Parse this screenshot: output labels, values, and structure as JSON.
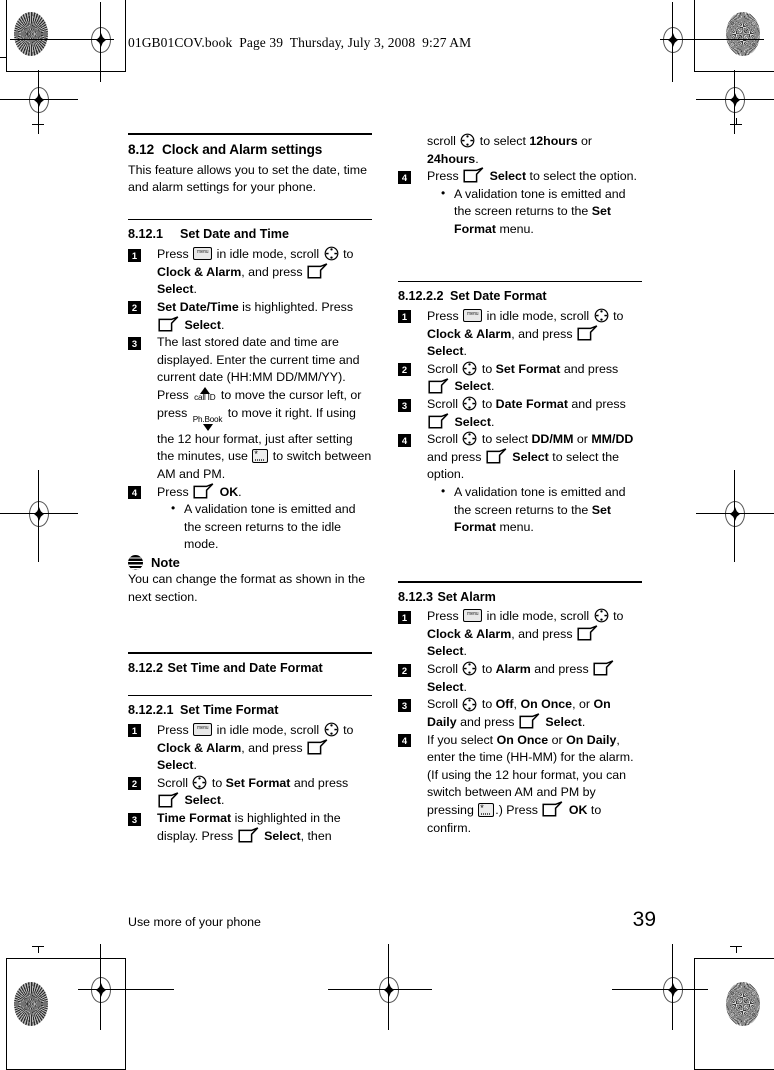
{
  "header": {
    "proof_line": "01GB01COV.book  Page 39  Thursday, July 3, 2008  9:27 AM"
  },
  "footer": {
    "running_title": "Use more of your phone",
    "page_number": "39"
  },
  "icons": {
    "menu_key": "menu",
    "star_key": "*",
    "call_id_label": "call ID",
    "phonebook_label": "Ph.Book",
    "soft_key": "soft-key",
    "scroll_key": "scroll-key",
    "note": "note-icon"
  },
  "left_column": {
    "section": {
      "number": "8.12",
      "title": "Clock and Alarm settings",
      "intro": "This feature allows you to set the date, time and alarm settings for your phone."
    },
    "sub1": {
      "number": "8.12.1",
      "title": "Set Date and Time",
      "steps": [
        {
          "n": "1",
          "parts": [
            {
              "t": "text",
              "v": "Press "
            },
            {
              "t": "icon",
              "v": "menu"
            },
            {
              "t": "text",
              "v": " in idle mode, scroll "
            },
            {
              "t": "icon",
              "v": "scroll"
            },
            {
              "t": "text",
              "v": " to "
            },
            {
              "t": "bold",
              "v": "Clock & Alarm"
            },
            {
              "t": "text",
              "v": ", and press "
            },
            {
              "t": "icon",
              "v": "soft"
            },
            {
              "t": "bold",
              "v": " Select"
            },
            {
              "t": "text",
              "v": "."
            }
          ]
        },
        {
          "n": "2",
          "parts": [
            {
              "t": "bold",
              "v": "Set Date/Time"
            },
            {
              "t": "text",
              "v": " is highlighted. Press "
            },
            {
              "t": "icon",
              "v": "soft"
            },
            {
              "t": "bold",
              "v": " Select"
            },
            {
              "t": "text",
              "v": "."
            }
          ]
        },
        {
          "n": "3",
          "parts": [
            {
              "t": "text",
              "v": "The last stored date and time are displayed. Enter the current time and current date (HH:MM DD/MM/YY). Press "
            },
            {
              "t": "icon",
              "v": "callid"
            },
            {
              "t": "text",
              "v": " to move the cursor left, or press "
            },
            {
              "t": "icon",
              "v": "phbook"
            },
            {
              "t": "text",
              "v": " to move it right. If using the 12 hour format, just after setting the minutes, use "
            },
            {
              "t": "icon",
              "v": "star"
            },
            {
              "t": "text",
              "v": " to switch between AM and PM."
            }
          ]
        },
        {
          "n": "4",
          "parts": [
            {
              "t": "text",
              "v": "Press "
            },
            {
              "t": "icon",
              "v": "soft"
            },
            {
              "t": "bold",
              "v": " OK"
            },
            {
              "t": "text",
              "v": "."
            }
          ],
          "bullets": [
            [
              {
                "t": "text",
                "v": "A validation tone is emitted and the screen returns to the idle mode."
              }
            ]
          ]
        }
      ],
      "note": {
        "label": "Note",
        "body": "You can change the format as shown in the next section."
      }
    },
    "sub2": {
      "number": "8.12.2",
      "title": "Set Time and Date Format"
    },
    "sub2_1": {
      "number": "8.12.2.1",
      "title": "Set Time Format",
      "steps": [
        {
          "n": "1",
          "parts": [
            {
              "t": "text",
              "v": "Press "
            },
            {
              "t": "icon",
              "v": "menu"
            },
            {
              "t": "text",
              "v": " in idle mode, scroll "
            },
            {
              "t": "icon",
              "v": "scroll"
            },
            {
              "t": "text",
              "v": " to "
            },
            {
              "t": "bold",
              "v": "Clock & Alarm"
            },
            {
              "t": "text",
              "v": ", and press "
            },
            {
              "t": "icon",
              "v": "soft"
            },
            {
              "t": "bold",
              "v": " Select"
            },
            {
              "t": "text",
              "v": "."
            }
          ]
        },
        {
          "n": "2",
          "parts": [
            {
              "t": "text",
              "v": "Scroll "
            },
            {
              "t": "icon",
              "v": "scroll"
            },
            {
              "t": "text",
              "v": " to "
            },
            {
              "t": "bold",
              "v": "Set Format"
            },
            {
              "t": "text",
              "v": " and press "
            },
            {
              "t": "icon",
              "v": "soft"
            },
            {
              "t": "bold",
              "v": " Select"
            },
            {
              "t": "text",
              "v": "."
            }
          ]
        },
        {
          "n": "3",
          "parts": [
            {
              "t": "bold",
              "v": "Time Format"
            },
            {
              "t": "text",
              "v": " is highlighted in the display. Press "
            },
            {
              "t": "icon",
              "v": "soft"
            },
            {
              "t": "bold",
              "v": " Select"
            },
            {
              "t": "text",
              "v": ", then"
            }
          ]
        }
      ]
    }
  },
  "right_column": {
    "continued": {
      "steps": [
        {
          "n": "",
          "parts": [
            {
              "t": "text",
              "v": "scroll "
            },
            {
              "t": "icon",
              "v": "scroll"
            },
            {
              "t": "text",
              "v": " to select "
            },
            {
              "t": "bold",
              "v": "12hours"
            },
            {
              "t": "text",
              "v": " or "
            },
            {
              "t": "bold",
              "v": "24hours"
            },
            {
              "t": "text",
              "v": "."
            }
          ]
        },
        {
          "n": "4",
          "parts": [
            {
              "t": "text",
              "v": "Press "
            },
            {
              "t": "icon",
              "v": "soft"
            },
            {
              "t": "bold",
              "v": " Select"
            },
            {
              "t": "text",
              "v": " to select the option."
            }
          ],
          "bullets": [
            [
              {
                "t": "text",
                "v": "A validation tone is emitted and the screen returns to the "
              },
              {
                "t": "bold",
                "v": "Set Format"
              },
              {
                "t": "text",
                "v": " menu."
              }
            ]
          ]
        }
      ]
    },
    "sub2_2": {
      "number": "8.12.2.2",
      "title": "Set Date Format",
      "steps": [
        {
          "n": "1",
          "parts": [
            {
              "t": "text",
              "v": "Press "
            },
            {
              "t": "icon",
              "v": "menu"
            },
            {
              "t": "text",
              "v": " in idle mode, scroll "
            },
            {
              "t": "icon",
              "v": "scroll"
            },
            {
              "t": "text",
              "v": " to "
            },
            {
              "t": "bold",
              "v": "Clock & Alarm"
            },
            {
              "t": "text",
              "v": ", and press "
            },
            {
              "t": "icon",
              "v": "soft"
            },
            {
              "t": "bold",
              "v": " Select"
            },
            {
              "t": "text",
              "v": "."
            }
          ]
        },
        {
          "n": "2",
          "parts": [
            {
              "t": "text",
              "v": "Scroll "
            },
            {
              "t": "icon",
              "v": "scroll"
            },
            {
              "t": "text",
              "v": " to "
            },
            {
              "t": "bold",
              "v": "Set Format"
            },
            {
              "t": "text",
              "v": " and press "
            },
            {
              "t": "icon",
              "v": "soft"
            },
            {
              "t": "bold",
              "v": " Select"
            },
            {
              "t": "text",
              "v": "."
            }
          ]
        },
        {
          "n": "3",
          "parts": [
            {
              "t": "text",
              "v": "Scroll "
            },
            {
              "t": "icon",
              "v": "scroll"
            },
            {
              "t": "text",
              "v": " to "
            },
            {
              "t": "bold",
              "v": "Date Format"
            },
            {
              "t": "text",
              "v": " and press "
            },
            {
              "t": "icon",
              "v": "soft"
            },
            {
              "t": "bold",
              "v": " Select"
            },
            {
              "t": "text",
              "v": "."
            }
          ]
        },
        {
          "n": "4",
          "parts": [
            {
              "t": "text",
              "v": "Scroll "
            },
            {
              "t": "icon",
              "v": "scroll"
            },
            {
              "t": "text",
              "v": " to select "
            },
            {
              "t": "bold",
              "v": "DD/MM"
            },
            {
              "t": "text",
              "v": " or "
            },
            {
              "t": "bold",
              "v": "MM/DD"
            },
            {
              "t": "text",
              "v": " and press "
            },
            {
              "t": "icon",
              "v": "soft"
            },
            {
              "t": "bold",
              "v": " Select"
            },
            {
              "t": "text",
              "v": " to select the option."
            }
          ],
          "bullets": [
            [
              {
                "t": "text",
                "v": "A validation tone is emitted and the screen returns to the "
              },
              {
                "t": "bold",
                "v": "Set Format"
              },
              {
                "t": "text",
                "v": " menu."
              }
            ]
          ]
        }
      ]
    },
    "sub3": {
      "number": "8.12.3",
      "title": "Set Alarm",
      "steps": [
        {
          "n": "1",
          "parts": [
            {
              "t": "text",
              "v": "Press "
            },
            {
              "t": "icon",
              "v": "menu"
            },
            {
              "t": "text",
              "v": " in idle mode, scroll "
            },
            {
              "t": "icon",
              "v": "scroll"
            },
            {
              "t": "text",
              "v": " to "
            },
            {
              "t": "bold",
              "v": "Clock & Alarm"
            },
            {
              "t": "text",
              "v": ", and press "
            },
            {
              "t": "icon",
              "v": "soft"
            },
            {
              "t": "bold",
              "v": " Select"
            },
            {
              "t": "text",
              "v": "."
            }
          ]
        },
        {
          "n": "2",
          "parts": [
            {
              "t": "text",
              "v": "Scroll "
            },
            {
              "t": "icon",
              "v": "scroll"
            },
            {
              "t": "text",
              "v": " to "
            },
            {
              "t": "bold",
              "v": "Alarm"
            },
            {
              "t": "text",
              "v": " and press "
            },
            {
              "t": "icon",
              "v": "soft"
            },
            {
              "t": "bold",
              "v": " Select"
            },
            {
              "t": "text",
              "v": "."
            }
          ]
        },
        {
          "n": "3",
          "parts": [
            {
              "t": "text",
              "v": "Scroll "
            },
            {
              "t": "icon",
              "v": "scroll"
            },
            {
              "t": "text",
              "v": " to "
            },
            {
              "t": "bold",
              "v": "Off"
            },
            {
              "t": "text",
              "v": ", "
            },
            {
              "t": "bold",
              "v": "On Once"
            },
            {
              "t": "text",
              "v": ", or "
            },
            {
              "t": "bold",
              "v": "On Daily"
            },
            {
              "t": "text",
              "v": " and press "
            },
            {
              "t": "icon",
              "v": "soft"
            },
            {
              "t": "bold",
              "v": " Select"
            },
            {
              "t": "text",
              "v": "."
            }
          ]
        },
        {
          "n": "4",
          "parts": [
            {
              "t": "text",
              "v": "If you select "
            },
            {
              "t": "bold",
              "v": "On Once"
            },
            {
              "t": "text",
              "v": " or "
            },
            {
              "t": "bold",
              "v": "On Daily"
            },
            {
              "t": "text",
              "v": ", enter the time (HH-MM) for the alarm. (If using the 12 hour format, you can switch between AM and PM by pressing "
            },
            {
              "t": "icon",
              "v": "star"
            },
            {
              "t": "text",
              "v": ".) Press "
            },
            {
              "t": "icon",
              "v": "soft"
            },
            {
              "t": "bold",
              "v": " OK"
            },
            {
              "t": "text",
              "v": " to confirm."
            }
          ]
        }
      ]
    }
  }
}
